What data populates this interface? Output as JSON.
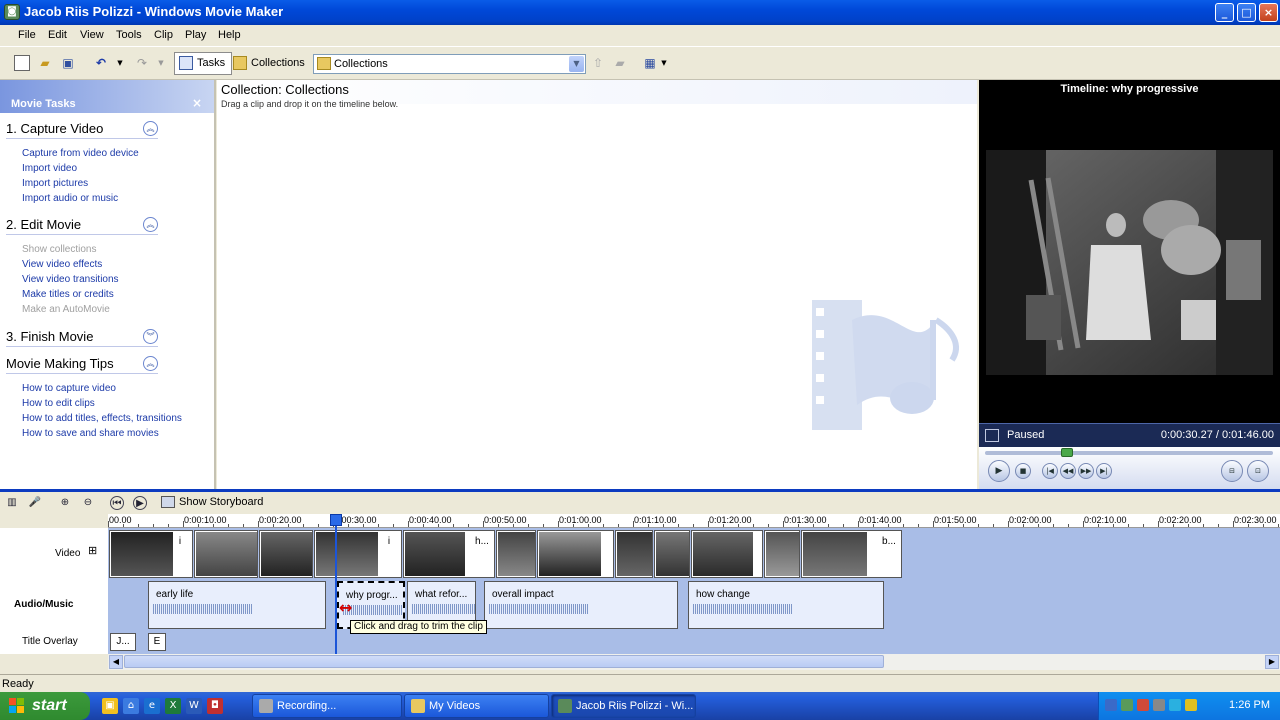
{
  "window": {
    "title": "Jacob Riis Polizzi - Windows Movie Maker"
  },
  "menu": [
    "File",
    "Edit",
    "View",
    "Tools",
    "Clip",
    "Play",
    "Help"
  ],
  "toolbar": {
    "tasks_label": "Tasks",
    "collections_label": "Collections",
    "collection_select": "Collections"
  },
  "tasks_pane": {
    "header": "Movie Tasks",
    "sections": [
      {
        "title": "1. Capture Video",
        "expanded": true,
        "links": [
          {
            "label": "Capture from video device",
            "enabled": true
          },
          {
            "label": "Import video",
            "enabled": true
          },
          {
            "label": "Import pictures",
            "enabled": true
          },
          {
            "label": "Import audio or music",
            "enabled": true
          }
        ]
      },
      {
        "title": "2. Edit Movie",
        "expanded": true,
        "links": [
          {
            "label": "Show collections",
            "enabled": false
          },
          {
            "label": "View video effects",
            "enabled": true
          },
          {
            "label": "View video transitions",
            "enabled": true
          },
          {
            "label": "Make titles or credits",
            "enabled": true
          },
          {
            "label": "Make an AutoMovie",
            "enabled": false
          }
        ]
      },
      {
        "title": "3. Finish Movie",
        "expanded": false,
        "links": []
      },
      {
        "title": "Movie Making Tips",
        "expanded": true,
        "links": [
          {
            "label": "How to capture video",
            "enabled": true
          },
          {
            "label": "How to edit clips",
            "enabled": true
          },
          {
            "label": "How to add titles, effects, transitions",
            "enabled": true
          },
          {
            "label": "How to save and share movies",
            "enabled": true
          }
        ]
      }
    ]
  },
  "collection": {
    "title": "Collection: Collections",
    "subtitle": "Drag a clip and drop it on the timeline below."
  },
  "preview": {
    "title": "Timeline: why progressive",
    "status": "Paused",
    "time": "0:00:30.27 / 0:01:46.00",
    "progress_fraction": 0.285
  },
  "timeline": {
    "storyboard_label": "Show Storyboard",
    "ruler_labels": [
      "00.00",
      "0:00:10.00",
      "0:00:20.00",
      "0:00:30.00",
      "0:00:40.00",
      "0:00:50.00",
      "0:01:00.00",
      "0:01:10.00",
      "0:01:20.00",
      "0:01:30.00",
      "0:01:40.00",
      "0:01:50.00",
      "0:02:00.00",
      "0:02:10.00",
      "0:02:20.00",
      "0:02:30.00"
    ],
    "track_labels": {
      "video": "Video",
      "audio": "Audio/Music",
      "title": "Title Overlay"
    },
    "video_clip_labels": [
      "i",
      "i",
      "h...",
      "b..."
    ],
    "audio_clips": [
      "early life",
      "why progr...",
      "what refor...",
      "overall impact",
      "how change"
    ],
    "title_clips": [
      "J...",
      "E"
    ],
    "tooltip": "Click and drag to trim the clip"
  },
  "status": {
    "text": "Ready"
  },
  "taskbar": {
    "start_label": "start",
    "tasks": [
      {
        "label": "Recording...",
        "active": false
      },
      {
        "label": "My Videos",
        "active": false
      },
      {
        "label": "Jacob Riis Polizzi - Wi...",
        "active": true
      }
    ],
    "clock": "1:26 PM"
  },
  "colors": {
    "titlebar": "#0a5ce8",
    "track_bg": "#a9bde7",
    "task_link": "#1c3aa8",
    "taskbar": "#245edb",
    "start": "#3c9a3c"
  }
}
